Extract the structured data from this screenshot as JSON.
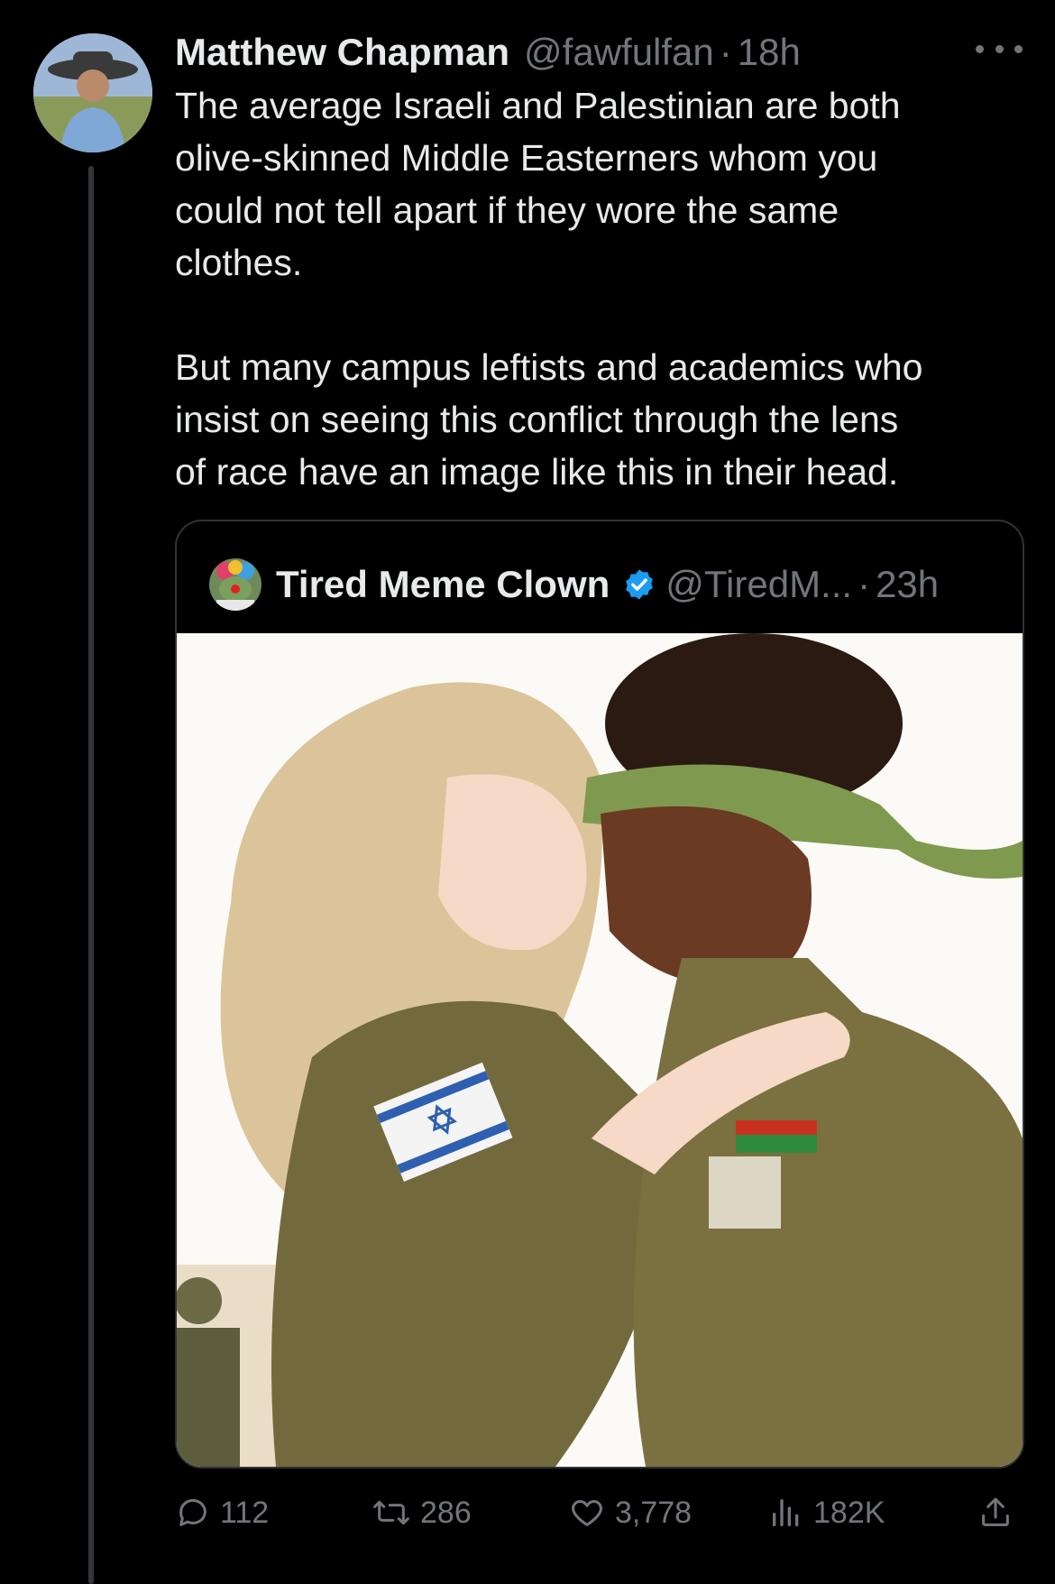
{
  "tweet": {
    "author_name": "Matthew Chapman",
    "author_handle": "@fawfulfan",
    "separator": "·",
    "time": "18h",
    "paragraphs": [
      "The average Israeli and Palestinian are both\nolive-skinned Middle Easterners whom you\ncould not tell apart if they wore the same\nclothes.",
      "But many campus leftists and academics who\ninsist on seeing this conflict through the lens\nof race have an image like this in their head."
    ],
    "more_icon": "more-horizontal-icon"
  },
  "quoted_tweet": {
    "author_name": "Tired Meme Clown",
    "author_handle": "@TiredM...",
    "separator": "·",
    "time": "23h",
    "verified_color": "#1d9bf0",
    "image_icon": "illustration-image"
  },
  "actions": {
    "replies": "112",
    "reposts": "286",
    "likes": "3,778",
    "views": "182K"
  },
  "colors": {
    "background": "#000000",
    "text": "#e7e9ea",
    "muted": "#71767b",
    "border": "#2f3336"
  }
}
